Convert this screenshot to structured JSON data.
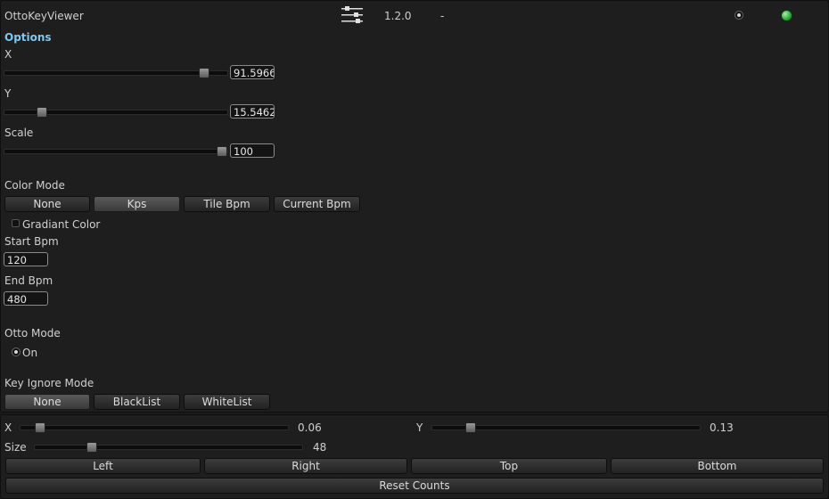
{
  "header": {
    "title": "OttoKeyViewer",
    "version": "1.2.0",
    "separator": "-",
    "icons": [
      "sliders-icon",
      "radio-toggle",
      "status-green-icon"
    ]
  },
  "options": {
    "header": "Options",
    "x": {
      "label": "X",
      "value": "91.5966",
      "slider_fraction": 0.92
    },
    "y": {
      "label": "Y",
      "value": "15.5462",
      "slider_fraction": 0.16
    },
    "scale": {
      "label": "Scale",
      "value": "100",
      "slider_fraction": 1.0
    },
    "color_mode": {
      "label": "Color Mode",
      "buttons": [
        "None",
        "Kps",
        "Tile Bpm",
        "Current Bpm"
      ],
      "selected": "Kps"
    },
    "gradiant_color": {
      "label": "Gradiant Color",
      "checked": false
    },
    "start_bpm": {
      "label": "Start Bpm",
      "value": "120"
    },
    "end_bpm": {
      "label": "End Bpm",
      "value": "480"
    },
    "otto_mode": {
      "label": "Otto Mode",
      "option": "On",
      "selected": true
    },
    "key_ignore_mode": {
      "label": "Key Ignore Mode",
      "buttons": [
        "None",
        "BlackList",
        "WhiteList"
      ],
      "selected": "None"
    }
  },
  "bottom": {
    "x": {
      "label": "X",
      "value": "0.06",
      "slider_fraction": 0.06
    },
    "y": {
      "label": "Y",
      "value": "0.13",
      "slider_fraction": 0.13
    },
    "size": {
      "label": "Size",
      "value": "48",
      "slider_fraction": 0.21
    },
    "align_buttons": [
      "Left",
      "Right",
      "Top",
      "Bottom"
    ],
    "reset_label": "Reset Counts"
  },
  "colors": {
    "background": "#1a1a1a",
    "panel": "#1e1e1e",
    "accent_header": "#7ec8f0",
    "status_green": "#27a83a"
  }
}
